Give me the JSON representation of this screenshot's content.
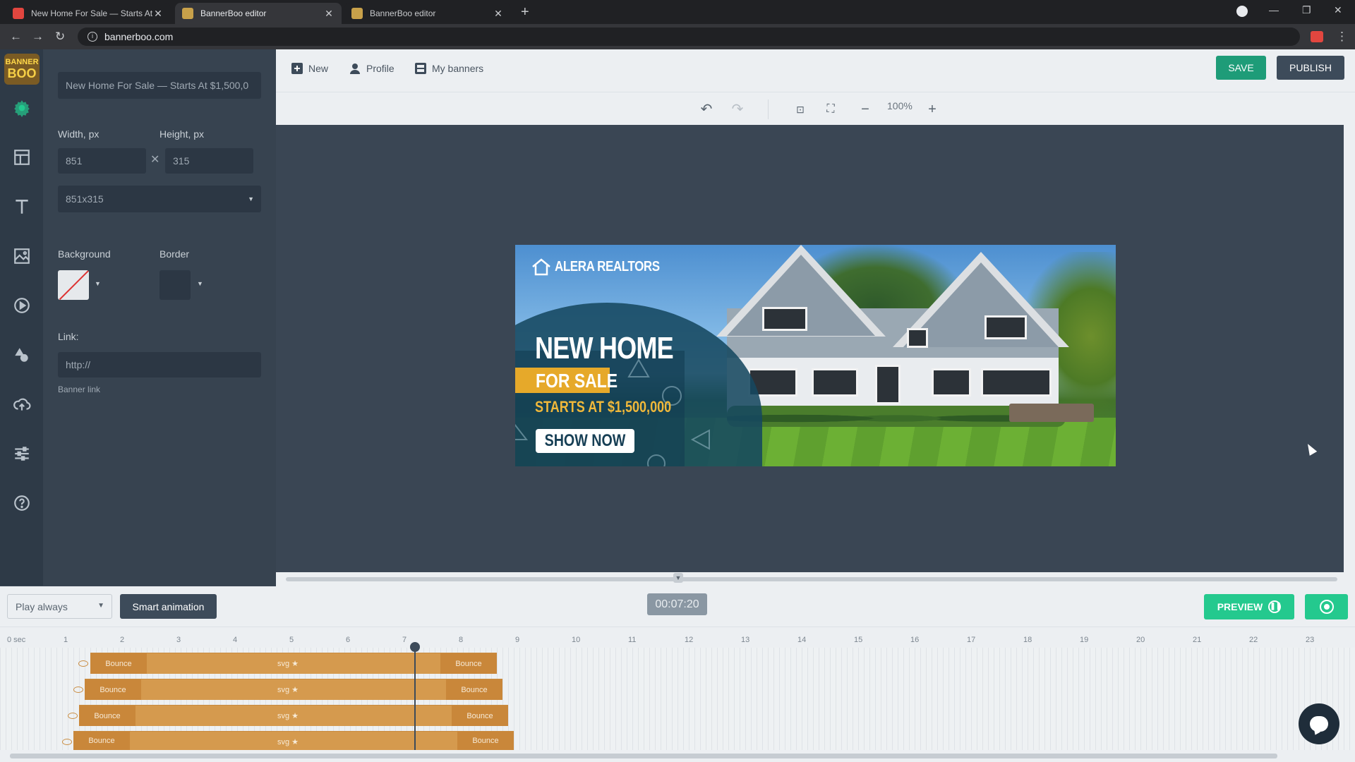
{
  "browser": {
    "tabs": [
      {
        "title": "New Home For Sale — Starts At $",
        "active": false
      },
      {
        "title": "BannerBoo editor",
        "active": true
      },
      {
        "title": "BannerBoo editor",
        "active": false
      }
    ],
    "url": "bannerboo.com"
  },
  "app": {
    "logo_top": "BANNER",
    "logo_bottom": "BOO",
    "rail_icons": [
      "settings-icon",
      "layout-icon",
      "text-icon",
      "image-icon",
      "video-icon",
      "shapes-icon",
      "upload-icon",
      "sliders-icon",
      "help-icon"
    ]
  },
  "panel": {
    "banner_name": "New Home For Sale — Starts At $1,500,0",
    "width_label": "Width, px",
    "height_label": "Height, px",
    "width_value": "851",
    "height_value": "315",
    "size_preset": "851x315",
    "background_label": "Background",
    "border_label": "Border",
    "link_label": "Link:",
    "link_placeholder": "http://",
    "link_hint": "Banner link"
  },
  "topbar": {
    "new_label": "New",
    "profile_label": "Profile",
    "my_banners_label": "My banners",
    "save_label": "SAVE",
    "publish_label": "PUBLISH",
    "zoom": "100%"
  },
  "banner": {
    "brand": "ALERA REALTORS",
    "headline": "NEW HOME",
    "tag": "FOR SALE",
    "price": "STARTS AT $1,500,000",
    "cta": "SHOW NOW"
  },
  "timeline": {
    "play_mode": "Play always",
    "smart_animation_label": "Smart animation",
    "timecode": "00:07:20",
    "preview_label": "PREVIEW",
    "ruler_first": "0 sec",
    "ruler": [
      "1",
      "2",
      "3",
      "4",
      "5",
      "6",
      "7",
      "8",
      "9",
      "10",
      "11",
      "12",
      "13",
      "14",
      "15",
      "16",
      "17",
      "18",
      "19",
      "20",
      "21",
      "22",
      "23"
    ],
    "tracks": [
      {
        "in": "Bounce",
        "mid": "svg",
        "out": "Bounce"
      },
      {
        "in": "Bounce",
        "mid": "svg",
        "out": "Bounce"
      },
      {
        "in": "Bounce",
        "mid": "svg",
        "out": "Bounce"
      },
      {
        "in": "Bounce",
        "mid": "svg",
        "out": "Bounce"
      }
    ]
  },
  "colors": {
    "accent_green": "#24c98e",
    "save_green": "#1e9c78",
    "panel_dark": "#374350",
    "banner_gold": "#e6a92a",
    "banner_teal": "#164860"
  }
}
